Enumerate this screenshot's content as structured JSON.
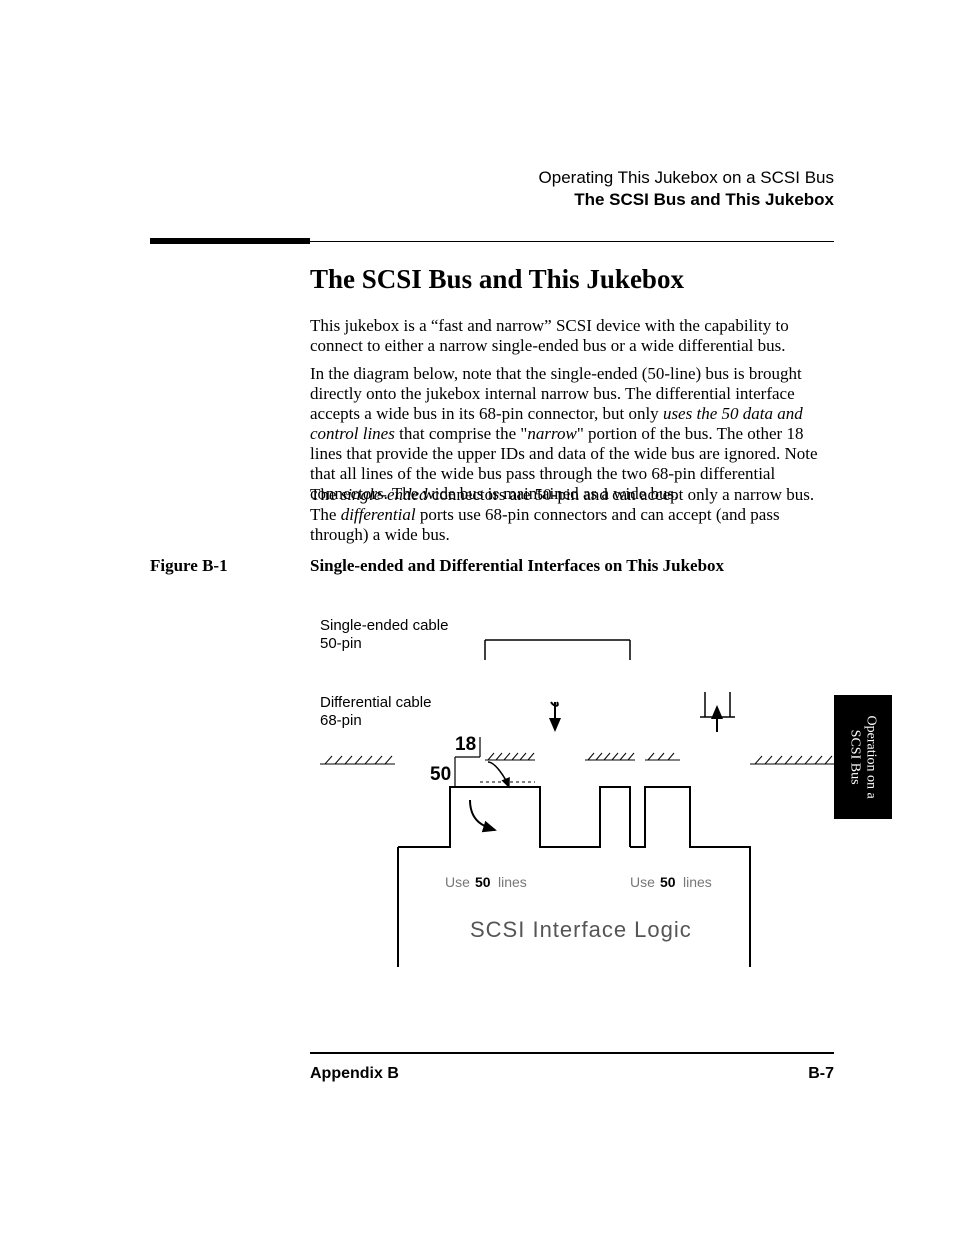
{
  "header": {
    "line1": "Operating This Jukebox on a SCSI Bus",
    "line2": "The SCSI Bus and This Jukebox"
  },
  "title": "The SCSI Bus and This Jukebox",
  "paragraphs": {
    "p1": "This jukebox is a “fast and narrow” SCSI device with the capability to connect to either a narrow single-ended bus or a wide differential bus.",
    "p2_a": "In the diagram below, note that the single-ended (50-line) bus is brought directly onto the jukebox internal narrow bus.  The differential interface accepts a wide bus in its 68-pin connector, but only ",
    "p2_b": "uses the 50 data and control lines",
    "p2_c": " that comprise the \"",
    "p2_d": "narrow",
    "p2_e": "\" portion of the bus. The other 18 lines that provide the upper IDs and data of the wide bus are ignored. Note that all lines of the wide bus pass through the two 68-pin differential connectors. The wide bus is maintained as a wide bus.",
    "p3_a": "The ",
    "p3_b": "single-ended",
    "p3_c": " connectors are 50-pin and can accept only a narrow bus. The ",
    "p3_d": "differential",
    "p3_e": " ports use 68-pin connectors and can accept (and pass through) a wide bus."
  },
  "figure": {
    "label": "Figure B-1",
    "caption": "Single-ended and Differential Interfaces on This Jukebox"
  },
  "diagram": {
    "se_label1": "Single-ended cable",
    "se_label2": "50-pin",
    "diff_label1": "Differential cable",
    "diff_label2": "68-pin",
    "num18": "18",
    "num50": "50",
    "use_a": "Use",
    "use_b": "50",
    "use_c": "lines",
    "logic": "SCSI Interface Logic"
  },
  "tab": {
    "line1": "Operation on a",
    "line2": "SCSI Bus"
  },
  "footer": {
    "left": "Appendix B",
    "right": "B-7"
  }
}
